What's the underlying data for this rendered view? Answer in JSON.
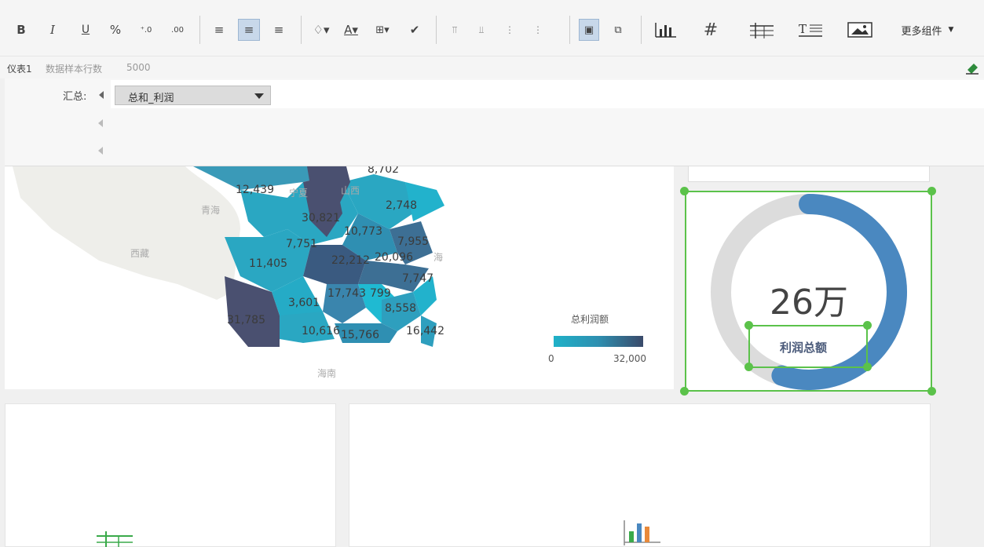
{
  "toolbar": {
    "bold": "B",
    "italic": "I",
    "underline": "U",
    "percent": "%",
    "dec_increase": ".00",
    "dec_decrease": ".00",
    "more_components": "更多组件"
  },
  "infobar": {
    "dashboard_name": "仪表1",
    "sample_rows_label": "数据样本行数",
    "sample_rows_value": "5000"
  },
  "summary": {
    "label": "汇总:",
    "selected_field": "总和_利润"
  },
  "map": {
    "values": [
      "8,702",
      "12,439",
      "30,821",
      "2,748",
      "10,773",
      "7,955",
      "7,751",
      "11,405",
      "22,212",
      "20,096",
      "7,747",
      "3,601",
      "17,743",
      "799",
      "8,558",
      "31,785",
      "10,616",
      "15,766",
      "16,442"
    ],
    "region_names": [
      "青海",
      "西藏",
      "山西",
      "宁夏",
      "海南",
      "海"
    ],
    "legend_title": "总利润额",
    "legend_min": "0",
    "legend_max": "32,000",
    "colors": {
      "low": "#1fb1c8",
      "high": "#3a4a6a",
      "land": "#eeeeea"
    }
  },
  "gauge": {
    "value": "26万",
    "label": "利润总额",
    "progress": 0.55,
    "colors": {
      "track": "#dcdcdc",
      "fill": "#4a88c0"
    }
  },
  "selection_color": "#5bc24a"
}
